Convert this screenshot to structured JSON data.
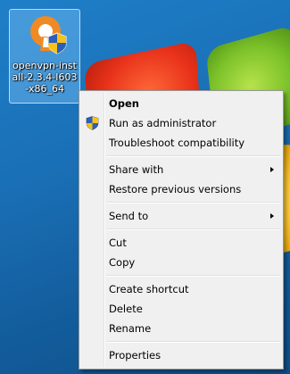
{
  "desktop": {
    "file_icon": {
      "label": "openvpn-install-2.3.4-I603-x86_64",
      "icon": "openvpn-installer-icon"
    }
  },
  "context_menu": {
    "items": [
      {
        "label": "Open",
        "bold": true
      },
      {
        "label": "Run as administrator",
        "icon": "uac-shield-icon"
      },
      {
        "label": "Troubleshoot compatibility"
      },
      {
        "label": "Share with",
        "submenu": true
      },
      {
        "label": "Restore previous versions"
      },
      {
        "label": "Send to",
        "submenu": true
      },
      {
        "label": "Cut"
      },
      {
        "label": "Copy"
      },
      {
        "label": "Create shortcut"
      },
      {
        "label": "Delete"
      },
      {
        "label": "Rename"
      },
      {
        "label": "Properties"
      }
    ]
  },
  "colors": {
    "desktop_bg": "#1a6fb5",
    "menu_bg": "#f0f0f0",
    "selection_bg": "#78bef5"
  }
}
